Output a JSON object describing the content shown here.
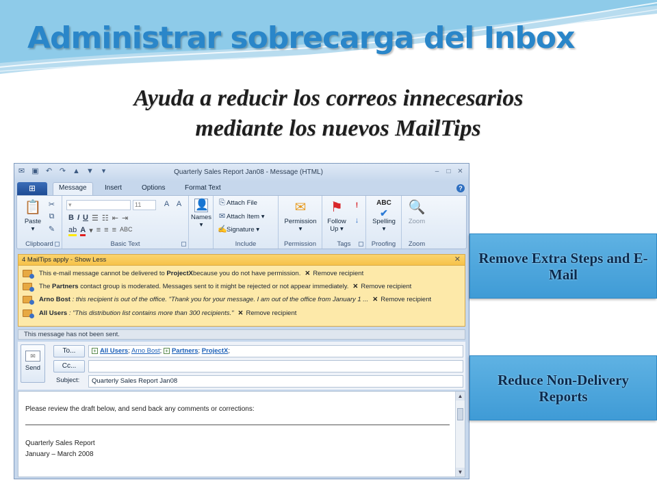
{
  "slide": {
    "title": "Administrar sobrecarga del Inbox",
    "subtitle_line1": "Ayuda a reducir los correos innecesarios",
    "subtitle_line2": "mediante los nuevos MailTips",
    "callout1": "Remove Extra Steps and E-Mail",
    "callout2": "Reduce Non-Delivery Reports",
    "accent_color": "#2a86c9",
    "callout_color": "#4aa6dd"
  },
  "window": {
    "title": "Quarterly Sales Report Jan08 - Message (HTML)",
    "tabs": [
      "Message",
      "Insert",
      "Options",
      "Format Text"
    ],
    "ribbon": {
      "clipboard": {
        "paste": "Paste",
        "label": "Clipboard"
      },
      "basic_text": {
        "font_size": "11",
        "label": "Basic Text"
      },
      "names": {
        "button": "Names"
      },
      "include": {
        "attach_file": "Attach File",
        "attach_item": "Attach Item",
        "signature": "Signature",
        "label": "Include"
      },
      "permission": {
        "button": "Permission",
        "label": "Permission"
      },
      "tags": {
        "follow_up_1": "Follow",
        "follow_up_2": "Up",
        "label": "Tags"
      },
      "proofing": {
        "spelling": "Spelling",
        "abc": "ABC",
        "label": "Proofing"
      },
      "zoom": {
        "button": "Zoom",
        "label": "Zoom"
      }
    },
    "mailtips": {
      "header": "4 MailTips apply  -  Show Less",
      "tips": [
        {
          "pre": "This e-mail message cannot be delivered to ",
          "bold": "ProjectX",
          "post": "because you do not have permission.",
          "action": "Remove recipient"
        },
        {
          "pre": "The ",
          "bold": "Partners",
          "post": " contact group is moderated. Messages sent to it might be rejected or not appear immediately.",
          "action": "Remove recipient"
        },
        {
          "pre": "",
          "bold": "Arno Bost",
          "post": " : this recipient is out of the office.  \"Thank you for your message. I am out of the office from January 1 ...",
          "action": "Remove recipient"
        },
        {
          "pre": "",
          "bold": "All Users",
          "post": " :  \"This distribution list contains more than 300 recipients.\"",
          "action": "Remove recipient"
        }
      ]
    },
    "status": "This message has not been sent.",
    "compose": {
      "send": "Send",
      "to_button": "To...",
      "cc_button": "Cc...",
      "subject_label": "Subject:",
      "to_recipients": [
        "All Users",
        "Arno Bost",
        "Partners",
        "ProjectX"
      ],
      "subject": "Quarterly Sales Report Jan08"
    },
    "body": {
      "line1": "Please review the draft below, and send back any comments or corrections:",
      "line2": "Quarterly Sales Report",
      "line3": "January – March 2008"
    }
  }
}
